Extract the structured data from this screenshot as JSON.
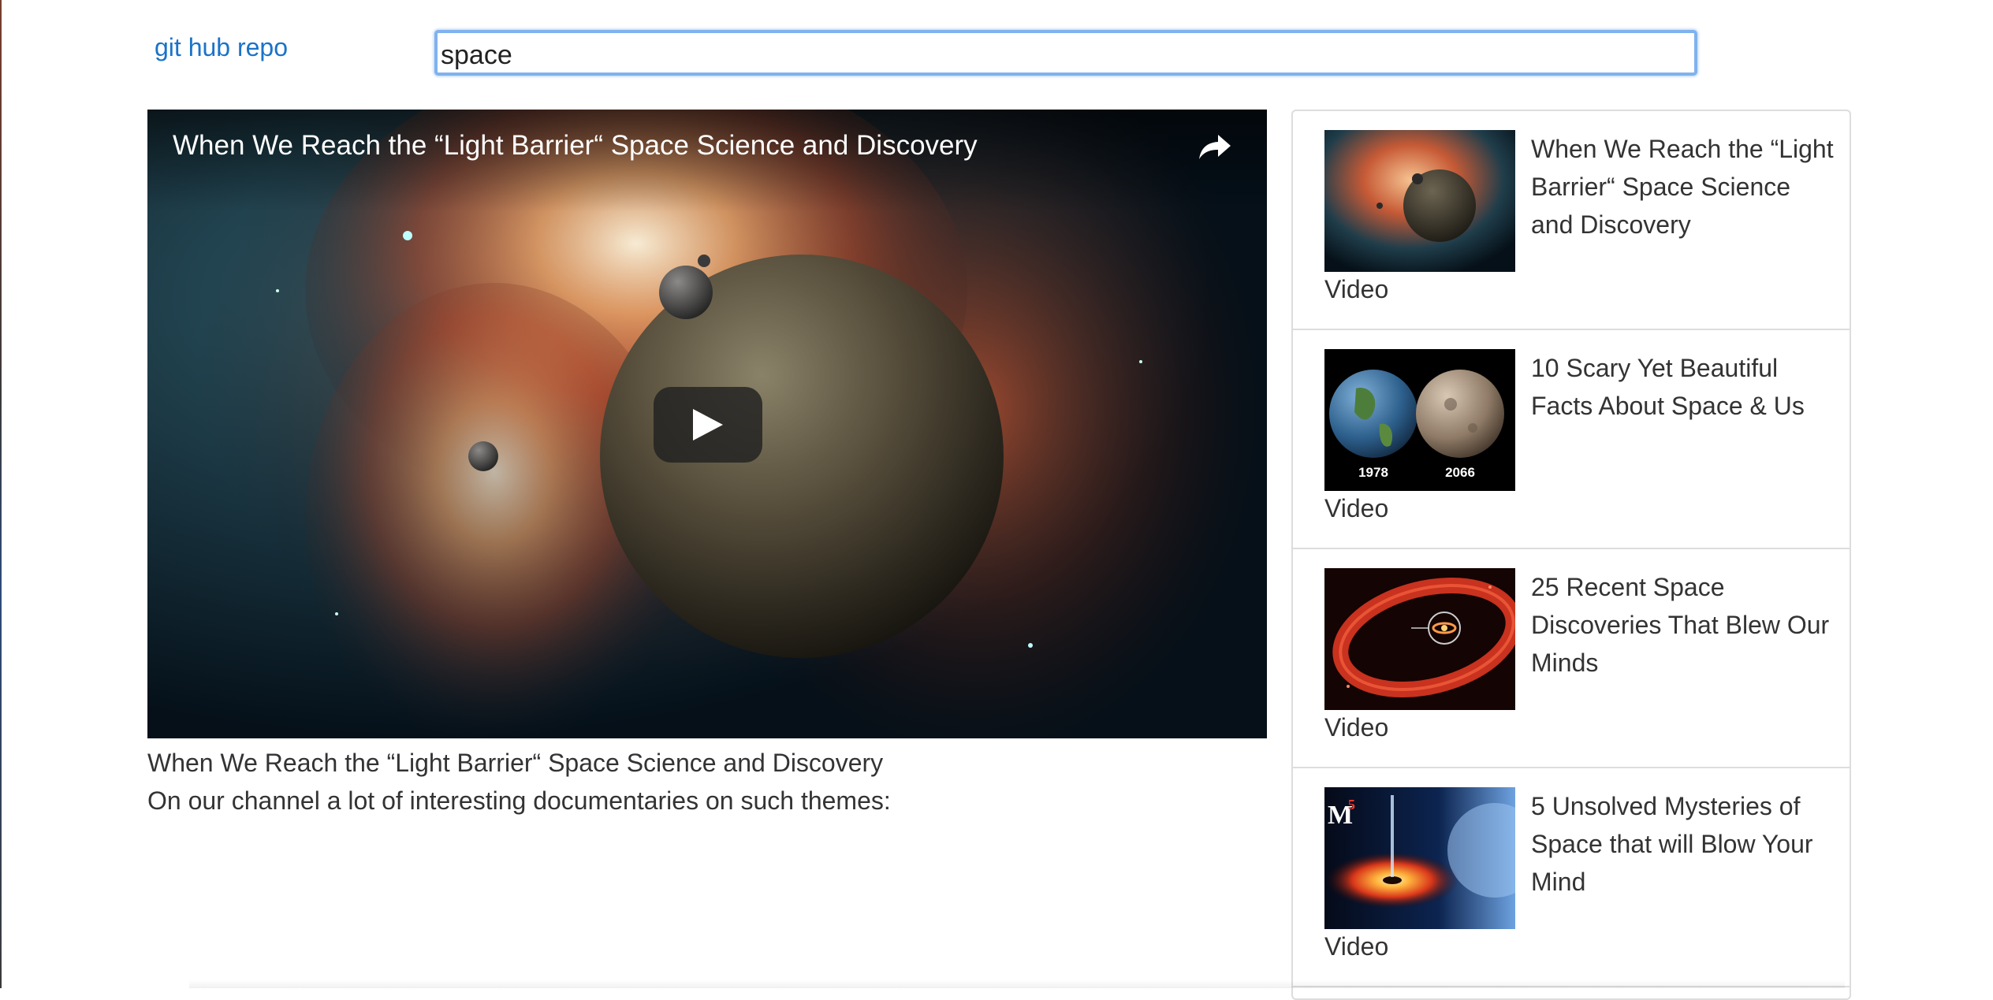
{
  "header": {
    "repo_link_label": "git hub repo",
    "search": {
      "value": "space",
      "placeholder": ""
    }
  },
  "player": {
    "title": "When We Reach the “Light Barrier“ Space Science and Discovery",
    "icons": {
      "share": "share-icon",
      "play": "play-icon"
    }
  },
  "video": {
    "title": "When We Reach the “Light Barrier“ Space Science and Discovery",
    "description": "On our channel a lot of interesting documentaries on such themes:"
  },
  "sidebar": {
    "items": [
      {
        "title": "When We Reach the “Light Barrier“ Space Science and Discovery",
        "type": "Video",
        "thumbnail": "nebula-planet"
      },
      {
        "title": "10 Scary Yet Beautiful Facts About Space & Us",
        "type": "Video",
        "thumbnail": "earth-comparison",
        "thumb_labels": [
          "1978",
          "2066"
        ]
      },
      {
        "title": "25 Recent Space Discoveries That Blew Our Minds",
        "type": "Video",
        "thumbnail": "red-ring-disc"
      },
      {
        "title": "5 Unsolved Mysteries of Space that will Blow Your Mind",
        "type": "Video",
        "thumbnail": "accretion-disk",
        "thumb_labels": [
          "M",
          "5"
        ]
      }
    ]
  }
}
